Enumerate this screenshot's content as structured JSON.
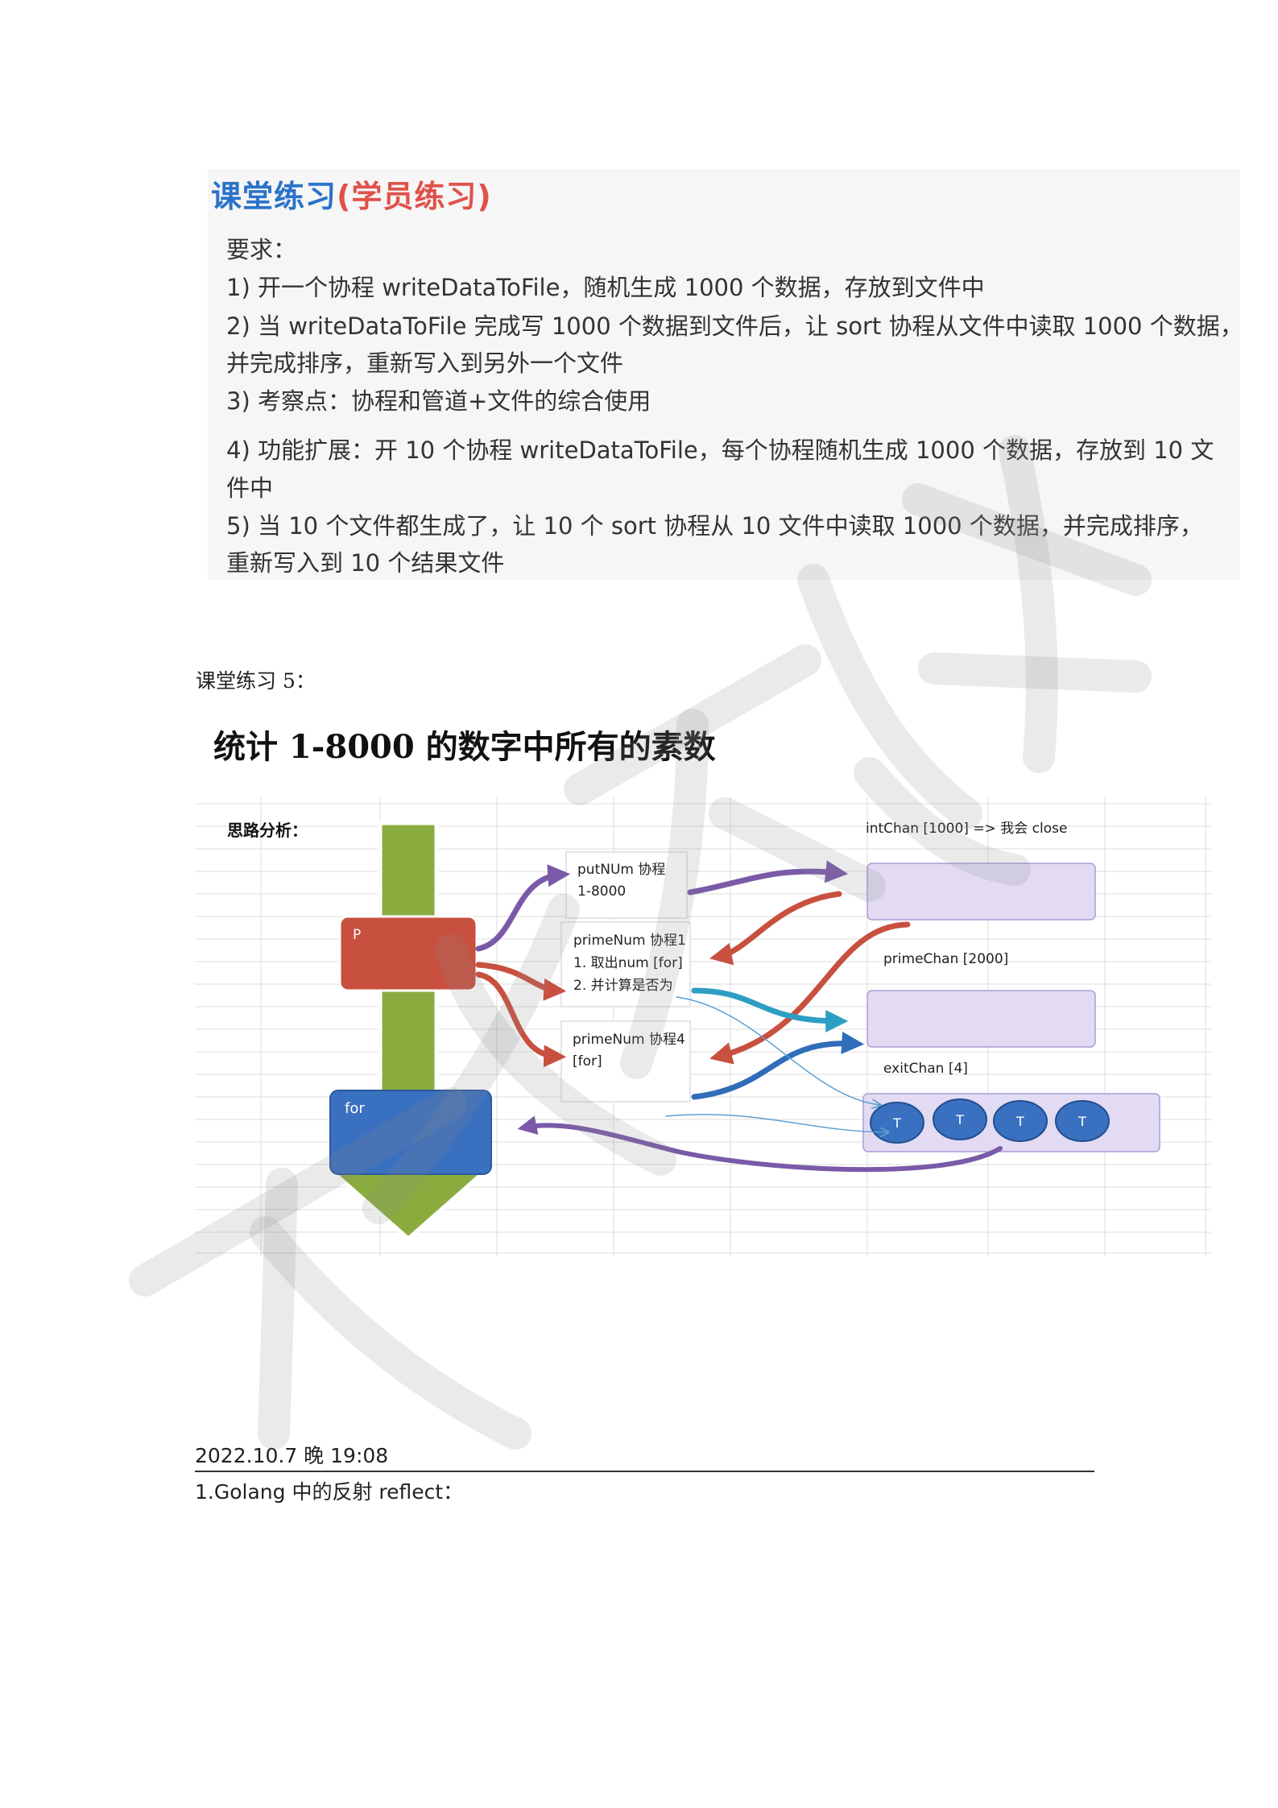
{
  "exercise": {
    "heading_blue": "课堂练习",
    "heading_red": "(学员练习)",
    "requirements": [
      "要求：",
      "1) 开一个协程 writeDataToFile，随机生成 1000 个数据，存放到文件中",
      "2) 当 writeDataToFile 完成写 1000 个数据到文件后，让 sort 协程从文件中读取 1000 个数据，",
      "并完成排序，重新写入到另外一个文件",
      "3) 考察点：协程和管道+文件的综合使用",
      "4) 功能扩展：开 10 个协程 writeDataToFile，每个协程随机生成 1000 个数据，存放到 10 文",
      "件中",
      "5) 当 10 个文件都生成了，让 10 个 sort 协程从 10 文件中读取 1000 个数据，并完成排序，",
      "重新写入到 10 个结果文件"
    ]
  },
  "exercise_label": "课堂练习 5：",
  "task_title": "统计 1-8000 的数字中所有的素数",
  "diagram": {
    "analysis_label": "思路分析：",
    "p_label": "P",
    "for_label": "for",
    "put_box": [
      "putNUm 协程",
      "1-8000"
    ],
    "prime1_box": [
      "primeNum 协程1",
      "1. 取出num [for]",
      "2. 并计算是否为"
    ],
    "prime4_box": [
      "primeNum 协程4",
      "[for]"
    ],
    "int_chan_label": "intChan [1000]  =>  我会 close",
    "prime_chan_label": "primeChan [2000]",
    "exit_chan_label": "exitChan [4]",
    "exit_tokens": [
      "T",
      "T",
      "T",
      "T"
    ],
    "colors": {
      "green": "#8aac3f",
      "red": "#c8503f",
      "blue": "#3a70c0",
      "purple_arrow": "#7a5aa8",
      "red_arrow": "#c8503f",
      "teal_arrow": "#2e9ec4",
      "blue_arrow": "#2f6db8",
      "chan_fill": "#e2dbf3"
    }
  },
  "note": {
    "date": "2022.10.7 晚 19:08",
    "line": "1.Golang 中的反射 reflect："
  }
}
